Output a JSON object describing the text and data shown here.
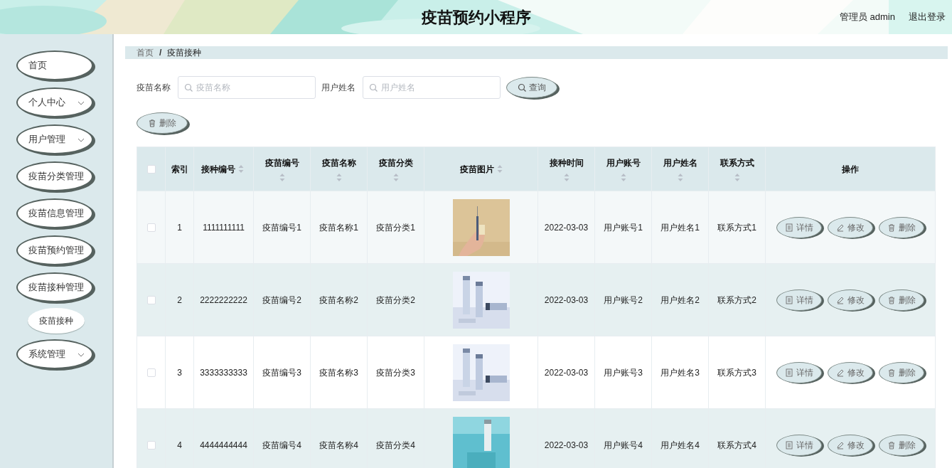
{
  "header": {
    "title": "疫苗预约小程序",
    "user": "管理员 admin",
    "logout": "退出登录"
  },
  "sidebar": {
    "items": [
      {
        "label": "首页",
        "has_dropdown": false,
        "selected": false
      },
      {
        "label": "个人中心",
        "has_dropdown": true,
        "selected": false
      },
      {
        "label": "用户管理",
        "has_dropdown": true,
        "selected": false
      },
      {
        "label": "疫苗分类管理",
        "has_dropdown": false,
        "selected": false
      },
      {
        "label": "疫苗信息管理",
        "has_dropdown": false,
        "selected": false
      },
      {
        "label": "疫苗预约管理",
        "has_dropdown": false,
        "selected": false
      },
      {
        "label": "疫苗接种管理",
        "has_dropdown": false,
        "selected": false,
        "children": [
          {
            "label": "疫苗接种",
            "selected": true
          }
        ]
      },
      {
        "label": "系统管理",
        "has_dropdown": true,
        "selected": false
      }
    ]
  },
  "breadcrumb": {
    "separator": "/",
    "items": [
      "首页",
      "疫苗接种"
    ]
  },
  "search": {
    "fields": [
      {
        "label": "疫苗名称",
        "placeholder": "疫苗名称"
      },
      {
        "label": "用户姓名",
        "placeholder": "用户姓名"
      }
    ],
    "button": "查询"
  },
  "toolbar": {
    "delete": "删除"
  },
  "table": {
    "select_all_checked": false,
    "columns": [
      {
        "label": "索引",
        "sortable": false
      },
      {
        "label": "接种编号",
        "sortable": true
      },
      {
        "label": "疫苗编号",
        "sortable": true
      },
      {
        "label": "疫苗名称",
        "sortable": true
      },
      {
        "label": "疫苗分类",
        "sortable": true
      },
      {
        "label": "疫苗图片",
        "sortable": true
      },
      {
        "label": "接种时间",
        "sortable": true
      },
      {
        "label": "用户账号",
        "sortable": true
      },
      {
        "label": "用户姓名",
        "sortable": true
      },
      {
        "label": "联系方式",
        "sortable": true
      },
      {
        "label": "操作",
        "sortable": false
      }
    ],
    "rows": [
      {
        "checked": false,
        "cells": [
          "1",
          "1111111111",
          "疫苗编号1",
          "疫苗名称1",
          "疫苗分类1",
          null,
          "2022-03-03",
          "用户账号1",
          "用户姓名1",
          "联系方式1"
        ],
        "image": {
          "kind": "picture"
        },
        "actions": [
          "详情",
          "修改",
          "删除"
        ]
      },
      {
        "checked": false,
        "cells": [
          "2",
          "2222222222",
          "疫苗编号2",
          "疫苗名称2",
          "疫苗分类2",
          null,
          "2022-03-03",
          "用户账号2",
          "用户姓名2",
          "联系方式2"
        ],
        "image": {
          "kind": "picture"
        },
        "actions": [
          "详情",
          "修改",
          "删除"
        ]
      },
      {
        "checked": false,
        "cells": [
          "3",
          "3333333333",
          "疫苗编号3",
          "疫苗名称3",
          "疫苗分类3",
          null,
          "2022-03-03",
          "用户账号3",
          "用户姓名3",
          "联系方式3"
        ],
        "image": {
          "kind": "picture"
        },
        "actions": [
          "详情",
          "修改",
          "删除"
        ]
      },
      {
        "checked": false,
        "cells": [
          "4",
          "4444444444",
          "疫苗编号4",
          "疫苗名称4",
          "疫苗分类4",
          null,
          "2022-03-03",
          "用户账号4",
          "用户姓名4",
          "联系方式4"
        ],
        "image": {
          "kind": "picture"
        },
        "actions": [
          "详情",
          "修改",
          "删除"
        ]
      }
    ]
  }
}
